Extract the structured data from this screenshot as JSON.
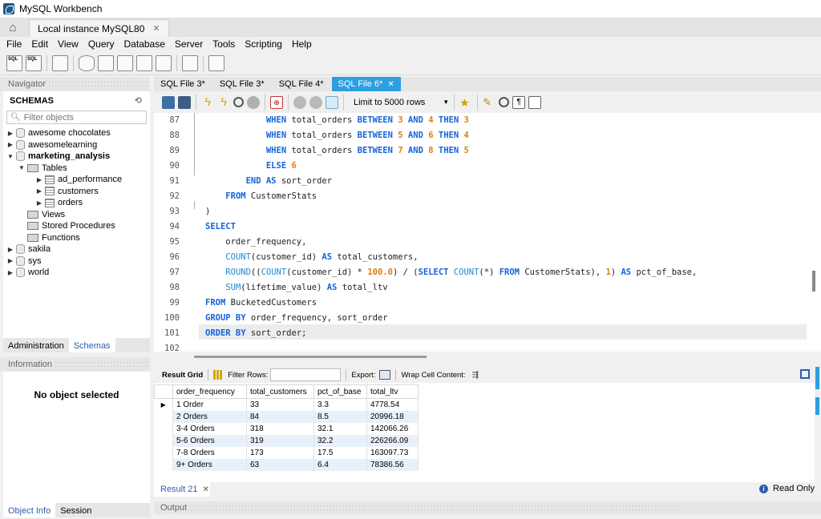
{
  "window": {
    "title": "MySQL Workbench"
  },
  "instance_tab": {
    "label": "Local instance MySQL80"
  },
  "menu": [
    "File",
    "Edit",
    "View",
    "Query",
    "Database",
    "Server",
    "Tools",
    "Scripting",
    "Help"
  ],
  "navigator": {
    "header": "Navigator",
    "schemas_title": "SCHEMAS",
    "filter_placeholder": "Filter objects",
    "schemas": [
      {
        "name": "awesome chocolates"
      },
      {
        "name": "awesomelearning"
      },
      {
        "name": "marketing_analysis"
      },
      {
        "name": "sakila"
      },
      {
        "name": "sys"
      },
      {
        "name": "world"
      }
    ],
    "marketing_children": {
      "tables_label": "Tables",
      "tables": [
        "ad_performance",
        "customers",
        "orders"
      ],
      "views_label": "Views",
      "procedures_label": "Stored Procedures",
      "functions_label": "Functions"
    },
    "tabs": [
      "Administration",
      "Schemas"
    ]
  },
  "information": {
    "header": "Information",
    "message": "No object selected",
    "tabs": [
      "Object Info",
      "Session"
    ]
  },
  "editor_tabs": [
    {
      "label": "SQL File 3*"
    },
    {
      "label": "SQL File 3*"
    },
    {
      "label": "SQL File 4*"
    },
    {
      "label": "SQL File 6*"
    }
  ],
  "editor_toolbar": {
    "limit_label": "Limit to 5000 rows"
  },
  "code": {
    "line_numbers": [
      "87",
      "88",
      "89",
      "90",
      "91",
      "92",
      "93",
      "94",
      "95",
      "96",
      "97",
      "98",
      "99",
      "100",
      "101",
      "102"
    ]
  },
  "result": {
    "toolbar": {
      "grid_label": "Result Grid",
      "filter_label": "Filter Rows:",
      "export_label": "Export:",
      "wrap_label": "Wrap Cell Content:"
    },
    "columns": [
      "order_frequency",
      "total_customers",
      "pct_of_base",
      "total_ltv"
    ],
    "rows": [
      [
        "1 Order",
        "33",
        "3.3",
        "4778.54"
      ],
      [
        "2 Orders",
        "84",
        "8.5",
        "20996.18"
      ],
      [
        "3-4 Orders",
        "318",
        "32.1",
        "142066.26"
      ],
      [
        "5-6 Orders",
        "319",
        "32.2",
        "226266.09"
      ],
      [
        "7-8 Orders",
        "173",
        "17.5",
        "163097.73"
      ],
      [
        "9+ Orders",
        "63",
        "6.4",
        "78386.56"
      ]
    ],
    "tab_label": "Result 21",
    "read_only": "Read Only"
  },
  "output": {
    "header": "Output"
  }
}
